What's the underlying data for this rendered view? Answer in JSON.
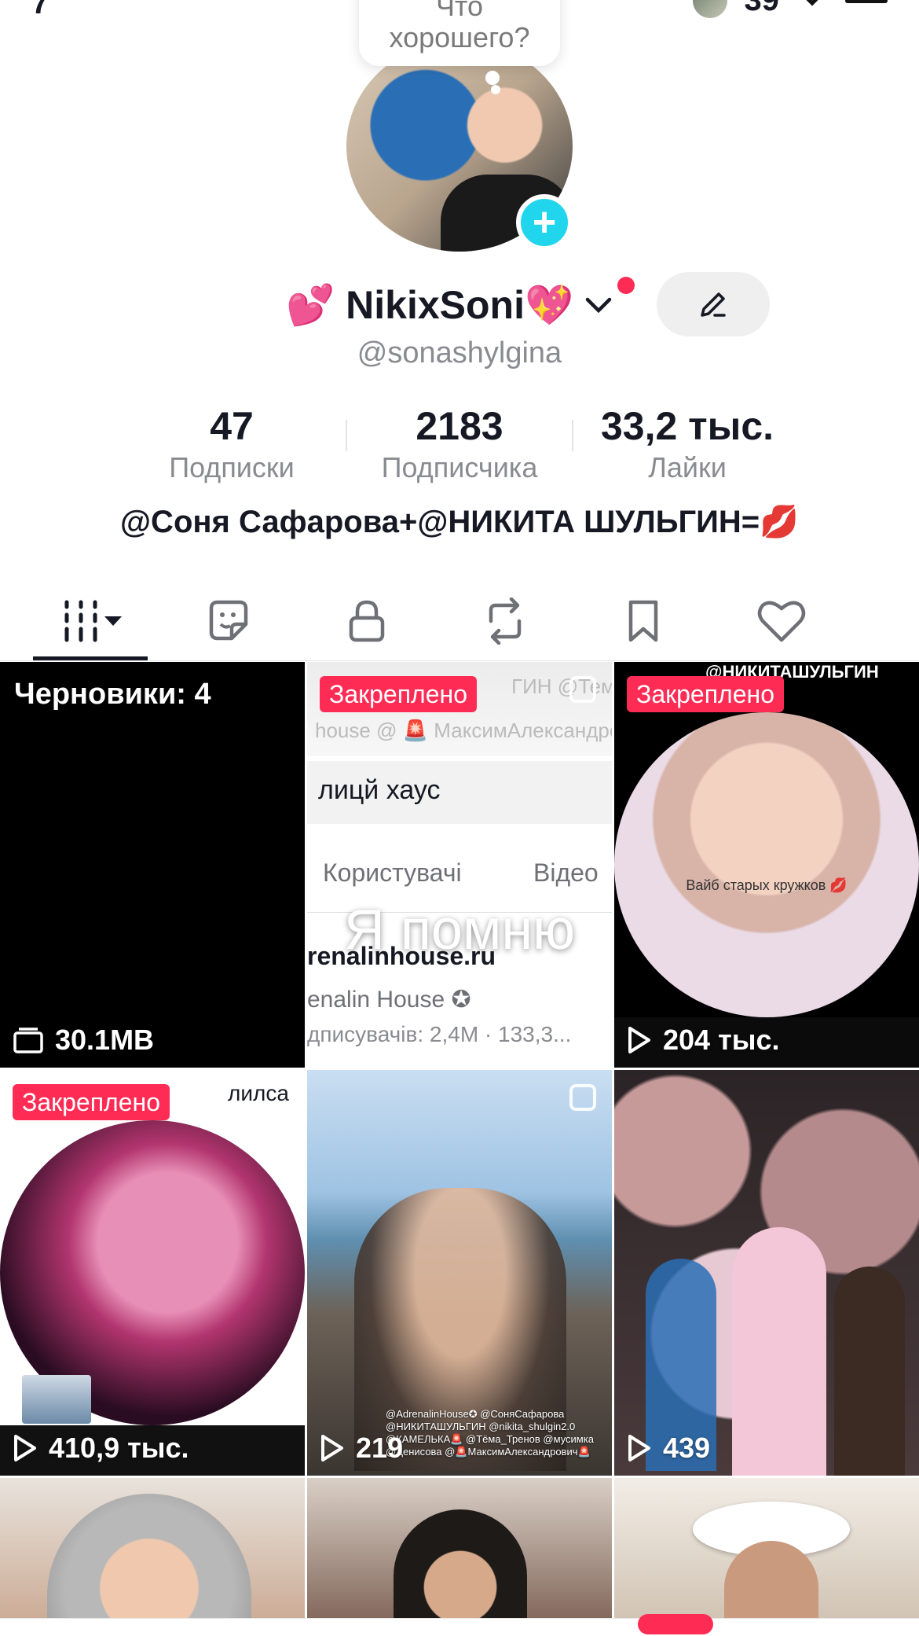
{
  "status": {
    "time_fragment": "7",
    "count_fragment": "39"
  },
  "bubble": {
    "line1": "Что",
    "line2": "хорошего?"
  },
  "profile": {
    "name": "💕 NikixSoni💖",
    "username": "@sonashylgina",
    "bio": "@Соня Сафарова+@НИКИТА ШУЛЬГИН=💋"
  },
  "stats": [
    {
      "value": "47",
      "label": "Подписки"
    },
    {
      "value": "2183",
      "label": "Подписчика"
    },
    {
      "value": "33,2 тыс.",
      "label": "Лайки"
    }
  ],
  "tabs": [
    {
      "icon": "grid-icon",
      "active": true
    },
    {
      "icon": "sticker-icon",
      "active": false
    },
    {
      "icon": "lock-icon",
      "active": false
    },
    {
      "icon": "repost-icon",
      "active": false
    },
    {
      "icon": "bookmark-icon",
      "active": false
    },
    {
      "icon": "heart-icon",
      "active": false
    }
  ],
  "grid": {
    "drafts_label": "Черновики: 4",
    "drafts_size": "30.1MB",
    "items": [
      {
        "pinned": "Закреплено",
        "overlay": "Я помню",
        "top_text": "ГИН @Тема @МарияДе",
        "top_text2": "house @ 🚨 МаксимАлександров",
        "search_text": "лицй хаус",
        "tabs_text1": "Користувачі",
        "tabs_text2": "Відео",
        "site": "renalinhouse.ru",
        "account": "enalin House ✪",
        "subs": "дписувачів: 2,4M · 133,3..."
      },
      {
        "pinned": "Закреплено",
        "top_text": "@НИКИТАШУЛЬГИН",
        "caption": "Вайб старых кружков 💋",
        "views": "204 тыс."
      },
      {
        "pinned": "Закреплено",
        "top_text": "лилса",
        "views": "410,9 тыс."
      },
      {
        "views": "219",
        "credits": "@AdrenalinHouse✪ @СоняСафарова @НИКИТАШУЛЬГИН @nikita_shulgin2.0 @КАМЕЛЬКА🚨 @Тёма_Тренов @мусимка @Денисова @🚨МаксимАлександрович🚨"
      },
      {
        "views": "439"
      }
    ]
  },
  "colors": {
    "accent": "#fe2c55",
    "cyan": "#20d5ec",
    "text": "#161823",
    "muted": "#8a8b91"
  }
}
